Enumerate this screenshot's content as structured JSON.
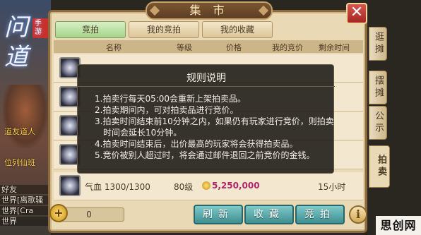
{
  "window": {
    "title": "集 市",
    "close_label": "✕"
  },
  "background": {
    "logo_text": "问道",
    "logo_tag": "手游",
    "labels": [
      "道友道人",
      "位列仙班"
    ],
    "chat": [
      "好友",
      "世界[离歌骚",
      "世界[Cra",
      "世界"
    ]
  },
  "tabs": [
    {
      "label": "竞拍",
      "active": true
    },
    {
      "label": "我的竞拍",
      "active": false
    },
    {
      "label": "我的收藏",
      "active": false
    }
  ],
  "side_tabs": [
    {
      "label": "逛摊",
      "active": false
    },
    {
      "label": "摆摊",
      "active": false
    },
    {
      "label": "公示",
      "active": false
    },
    {
      "label": "拍卖",
      "active": true
    }
  ],
  "table": {
    "headers": [
      "名称",
      "等级",
      "价格",
      "我的竞价",
      "剩余时间"
    ],
    "rows": [
      {
        "name": "",
        "level": "",
        "price": "",
        "my_bid": "",
        "time": ""
      },
      {
        "name": "",
        "level": "",
        "price": "",
        "my_bid": "",
        "time": ""
      },
      {
        "name": "",
        "level": "",
        "price": "",
        "my_bid": "",
        "time": ""
      },
      {
        "name": "",
        "level": "",
        "price": "",
        "my_bid": "",
        "time": ""
      },
      {
        "name": "气血 1300/1300",
        "level": "80级",
        "price": "5,250,000",
        "my_bid": "",
        "time": "15小时"
      }
    ]
  },
  "bottom": {
    "coin_value": "0",
    "coin_plus": "+",
    "refresh_label": "刷新",
    "favorite_label": "收藏",
    "bid_label": "竞拍",
    "info_label": "i"
  },
  "modal": {
    "title": "规则说明",
    "lines": [
      "1.拍卖行每天05:00会重新上架拍卖品。",
      "2.拍卖期间内，可对拍卖品进行竞价。",
      "3.拍卖时间结束前10分钟之内，如果仍有玩家进行竞价，则拍卖",
      "时间会延长10分钟。",
      "4.拍卖时间结束后，出价最高的玩家将会获得拍卖品。",
      "5.竞价被别人超过时，将会通过邮件退回之前竞价的金钱。"
    ]
  },
  "watermark": "思创网",
  "colors": {
    "panel_bg": "#e9d9b5",
    "active_tab": "#a6d48a",
    "button_teal": "#3f8f91",
    "price_color": "#b0246c",
    "close_red": "#a52622"
  }
}
